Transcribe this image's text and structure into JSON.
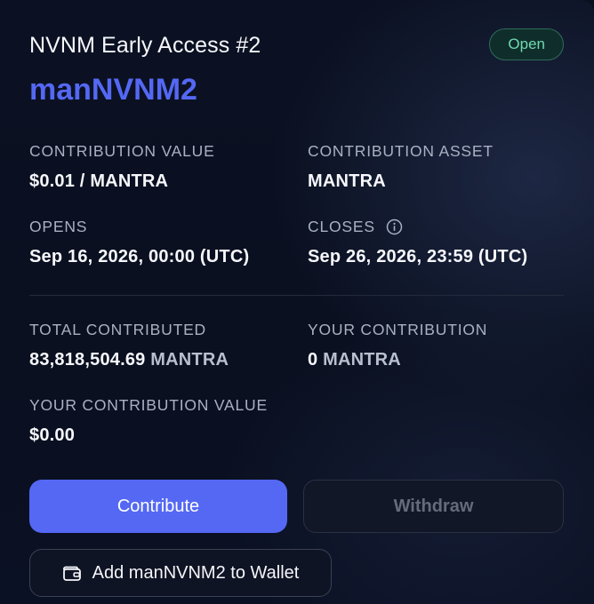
{
  "header": {
    "title": "NVNM Early Access #2",
    "status": "Open"
  },
  "token_name": "manNVNM2",
  "details": {
    "contribution_value": {
      "label": "CONTRIBUTION VALUE",
      "value": "$0.01 / MANTRA"
    },
    "contribution_asset": {
      "label": "CONTRIBUTION ASSET",
      "value": "MANTRA"
    },
    "opens": {
      "label": "OPENS",
      "value": "Sep 16, 2026, 00:00 (UTC)"
    },
    "closes": {
      "label": "CLOSES",
      "value": "Sep 26, 2026, 23:59 (UTC)",
      "icon": "info-icon"
    }
  },
  "stats": {
    "total_contributed": {
      "label": "TOTAL CONTRIBUTED",
      "amount": "83,818,504.69",
      "unit": "MANTRA"
    },
    "your_contribution": {
      "label": "YOUR CONTRIBUTION",
      "amount": "0",
      "unit": "MANTRA"
    },
    "your_contribution_value": {
      "label": "YOUR CONTRIBUTION VALUE",
      "value": "$0.00"
    }
  },
  "actions": {
    "contribute_label": "Contribute",
    "withdraw_label": "Withdraw",
    "add_wallet_label": "Add manNVNM2 to Wallet",
    "add_wallet_icon": "wallet-icon"
  },
  "colors": {
    "accent": "#5468f4",
    "status_text": "#6fd9b0",
    "status_bg": "#0f2e2b",
    "background": "#0a0f1e"
  }
}
